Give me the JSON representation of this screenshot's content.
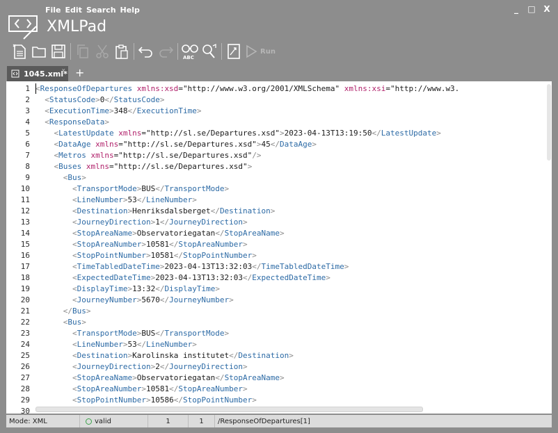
{
  "app": {
    "title": "XMLPad",
    "menu": [
      "File",
      "Edit",
      "Search",
      "Help"
    ],
    "window_controls": {
      "minimize": "_",
      "maximize": "□",
      "close": "X"
    }
  },
  "toolbar": {
    "buttons": [
      "new-file-icon",
      "open-folder-icon",
      "save-icon",
      "copy-icon",
      "cut-icon",
      "paste-icon",
      "undo-icon",
      "redo-icon",
      "spellcheck-icon",
      "find-replace-icon",
      "xpath-icon",
      "run-icon"
    ],
    "run_label": "Run"
  },
  "tabs": [
    {
      "label": "1045.xml*",
      "close": "x"
    }
  ],
  "tab_add": "+",
  "editor": {
    "lines": [
      [
        [
          "b",
          "<"
        ],
        [
          "t",
          "ResponseOfDepartures"
        ],
        [
          "x",
          " "
        ],
        [
          "a",
          "xmlns:xsd"
        ],
        [
          "e",
          "="
        ],
        [
          "v",
          "\"http://www.w3.org/2001/XMLSchema\""
        ],
        [
          "x",
          " "
        ],
        [
          "a",
          "xmlns:xsi"
        ],
        [
          "e",
          "="
        ],
        [
          "v",
          "\"http://www.w3."
        ]
      ],
      [
        [
          "x",
          "  "
        ],
        [
          "b",
          "<"
        ],
        [
          "t",
          "StatusCode"
        ],
        [
          "b",
          ">"
        ],
        [
          "x",
          "0"
        ],
        [
          "b",
          "</"
        ],
        [
          "t",
          "StatusCode"
        ],
        [
          "b",
          ">"
        ]
      ],
      [
        [
          "x",
          "  "
        ],
        [
          "b",
          "<"
        ],
        [
          "t",
          "ExecutionTime"
        ],
        [
          "b",
          ">"
        ],
        [
          "x",
          "348"
        ],
        [
          "b",
          "</"
        ],
        [
          "t",
          "ExecutionTime"
        ],
        [
          "b",
          ">"
        ]
      ],
      [
        [
          "x",
          "  "
        ],
        [
          "b",
          "<"
        ],
        [
          "t",
          "ResponseData"
        ],
        [
          "b",
          ">"
        ]
      ],
      [
        [
          "x",
          "    "
        ],
        [
          "b",
          "<"
        ],
        [
          "t",
          "LatestUpdate"
        ],
        [
          "x",
          " "
        ],
        [
          "a",
          "xmlns"
        ],
        [
          "e",
          "="
        ],
        [
          "v",
          "\"http://sl.se/Departures.xsd\""
        ],
        [
          "b",
          ">"
        ],
        [
          "x",
          "2023-04-13T13:19:50"
        ],
        [
          "b",
          "</"
        ],
        [
          "t",
          "LatestUpdate"
        ],
        [
          "b",
          ">"
        ]
      ],
      [
        [
          "x",
          "    "
        ],
        [
          "b",
          "<"
        ],
        [
          "t",
          "DataAge"
        ],
        [
          "x",
          " "
        ],
        [
          "a",
          "xmlns"
        ],
        [
          "e",
          "="
        ],
        [
          "v",
          "\"http://sl.se/Departures.xsd\""
        ],
        [
          "b",
          ">"
        ],
        [
          "x",
          "45"
        ],
        [
          "b",
          "</"
        ],
        [
          "t",
          "DataAge"
        ],
        [
          "b",
          ">"
        ]
      ],
      [
        [
          "x",
          "    "
        ],
        [
          "b",
          "<"
        ],
        [
          "t",
          "Metros"
        ],
        [
          "x",
          " "
        ],
        [
          "a",
          "xmlns"
        ],
        [
          "e",
          "="
        ],
        [
          "v",
          "\"http://sl.se/Departures.xsd\""
        ],
        [
          "b",
          "/>"
        ]
      ],
      [
        [
          "x",
          "    "
        ],
        [
          "b",
          "<"
        ],
        [
          "t",
          "Buses"
        ],
        [
          "x",
          " "
        ],
        [
          "a",
          "xmlns"
        ],
        [
          "e",
          "="
        ],
        [
          "v",
          "\"http://sl.se/Departures.xsd\""
        ],
        [
          "b",
          ">"
        ]
      ],
      [
        [
          "x",
          "      "
        ],
        [
          "b",
          "<"
        ],
        [
          "t",
          "Bus"
        ],
        [
          "b",
          ">"
        ]
      ],
      [
        [
          "x",
          "        "
        ],
        [
          "b",
          "<"
        ],
        [
          "t",
          "TransportMode"
        ],
        [
          "b",
          ">"
        ],
        [
          "x",
          "BUS"
        ],
        [
          "b",
          "</"
        ],
        [
          "t",
          "TransportMode"
        ],
        [
          "b",
          ">"
        ]
      ],
      [
        [
          "x",
          "        "
        ],
        [
          "b",
          "<"
        ],
        [
          "t",
          "LineNumber"
        ],
        [
          "b",
          ">"
        ],
        [
          "x",
          "53"
        ],
        [
          "b",
          "</"
        ],
        [
          "t",
          "LineNumber"
        ],
        [
          "b",
          ">"
        ]
      ],
      [
        [
          "x",
          "        "
        ],
        [
          "b",
          "<"
        ],
        [
          "t",
          "Destination"
        ],
        [
          "b",
          ">"
        ],
        [
          "x",
          "Henriksdalsberget"
        ],
        [
          "b",
          "</"
        ],
        [
          "t",
          "Destination"
        ],
        [
          "b",
          ">"
        ]
      ],
      [
        [
          "x",
          "        "
        ],
        [
          "b",
          "<"
        ],
        [
          "t",
          "JourneyDirection"
        ],
        [
          "b",
          ">"
        ],
        [
          "x",
          "1"
        ],
        [
          "b",
          "</"
        ],
        [
          "t",
          "JourneyDirection"
        ],
        [
          "b",
          ">"
        ]
      ],
      [
        [
          "x",
          "        "
        ],
        [
          "b",
          "<"
        ],
        [
          "t",
          "StopAreaName"
        ],
        [
          "b",
          ">"
        ],
        [
          "x",
          "Observatoriegatan"
        ],
        [
          "b",
          "</"
        ],
        [
          "t",
          "StopAreaName"
        ],
        [
          "b",
          ">"
        ]
      ],
      [
        [
          "x",
          "        "
        ],
        [
          "b",
          "<"
        ],
        [
          "t",
          "StopAreaNumber"
        ],
        [
          "b",
          ">"
        ],
        [
          "x",
          "10581"
        ],
        [
          "b",
          "</"
        ],
        [
          "t",
          "StopAreaNumber"
        ],
        [
          "b",
          ">"
        ]
      ],
      [
        [
          "x",
          "        "
        ],
        [
          "b",
          "<"
        ],
        [
          "t",
          "StopPointNumber"
        ],
        [
          "b",
          ">"
        ],
        [
          "x",
          "10581"
        ],
        [
          "b",
          "</"
        ],
        [
          "t",
          "StopPointNumber"
        ],
        [
          "b",
          ">"
        ]
      ],
      [
        [
          "x",
          "        "
        ],
        [
          "b",
          "<"
        ],
        [
          "t",
          "TimeTabledDateTime"
        ],
        [
          "b",
          ">"
        ],
        [
          "x",
          "2023-04-13T13:32:03"
        ],
        [
          "b",
          "</"
        ],
        [
          "t",
          "TimeTabledDateTime"
        ],
        [
          "b",
          ">"
        ]
      ],
      [
        [
          "x",
          "        "
        ],
        [
          "b",
          "<"
        ],
        [
          "t",
          "ExpectedDateTime"
        ],
        [
          "b",
          ">"
        ],
        [
          "x",
          "2023-04-13T13:32:03"
        ],
        [
          "b",
          "</"
        ],
        [
          "t",
          "ExpectedDateTime"
        ],
        [
          "b",
          ">"
        ]
      ],
      [
        [
          "x",
          "        "
        ],
        [
          "b",
          "<"
        ],
        [
          "t",
          "DisplayTime"
        ],
        [
          "b",
          ">"
        ],
        [
          "x",
          "13:32"
        ],
        [
          "b",
          "</"
        ],
        [
          "t",
          "DisplayTime"
        ],
        [
          "b",
          ">"
        ]
      ],
      [
        [
          "x",
          "        "
        ],
        [
          "b",
          "<"
        ],
        [
          "t",
          "JourneyNumber"
        ],
        [
          "b",
          ">"
        ],
        [
          "x",
          "5670"
        ],
        [
          "b",
          "</"
        ],
        [
          "t",
          "JourneyNumber"
        ],
        [
          "b",
          ">"
        ]
      ],
      [
        [
          "x",
          "      "
        ],
        [
          "b",
          "</"
        ],
        [
          "t",
          "Bus"
        ],
        [
          "b",
          ">"
        ]
      ],
      [
        [
          "x",
          "      "
        ],
        [
          "b",
          "<"
        ],
        [
          "t",
          "Bus"
        ],
        [
          "b",
          ">"
        ]
      ],
      [
        [
          "x",
          "        "
        ],
        [
          "b",
          "<"
        ],
        [
          "t",
          "TransportMode"
        ],
        [
          "b",
          ">"
        ],
        [
          "x",
          "BUS"
        ],
        [
          "b",
          "</"
        ],
        [
          "t",
          "TransportMode"
        ],
        [
          "b",
          ">"
        ]
      ],
      [
        [
          "x",
          "        "
        ],
        [
          "b",
          "<"
        ],
        [
          "t",
          "LineNumber"
        ],
        [
          "b",
          ">"
        ],
        [
          "x",
          "53"
        ],
        [
          "b",
          "</"
        ],
        [
          "t",
          "LineNumber"
        ],
        [
          "b",
          ">"
        ]
      ],
      [
        [
          "x",
          "        "
        ],
        [
          "b",
          "<"
        ],
        [
          "t",
          "Destination"
        ],
        [
          "b",
          ">"
        ],
        [
          "x",
          "Karolinska institutet"
        ],
        [
          "b",
          "</"
        ],
        [
          "t",
          "Destination"
        ],
        [
          "b",
          ">"
        ]
      ],
      [
        [
          "x",
          "        "
        ],
        [
          "b",
          "<"
        ],
        [
          "t",
          "JourneyDirection"
        ],
        [
          "b",
          ">"
        ],
        [
          "x",
          "2"
        ],
        [
          "b",
          "</"
        ],
        [
          "t",
          "JourneyDirection"
        ],
        [
          "b",
          ">"
        ]
      ],
      [
        [
          "x",
          "        "
        ],
        [
          "b",
          "<"
        ],
        [
          "t",
          "StopAreaName"
        ],
        [
          "b",
          ">"
        ],
        [
          "x",
          "Observatoriegatan"
        ],
        [
          "b",
          "</"
        ],
        [
          "t",
          "StopAreaName"
        ],
        [
          "b",
          ">"
        ]
      ],
      [
        [
          "x",
          "        "
        ],
        [
          "b",
          "<"
        ],
        [
          "t",
          "StopAreaNumber"
        ],
        [
          "b",
          ">"
        ],
        [
          "x",
          "10581"
        ],
        [
          "b",
          "</"
        ],
        [
          "t",
          "StopAreaNumber"
        ],
        [
          "b",
          ">"
        ]
      ],
      [
        [
          "x",
          "        "
        ],
        [
          "b",
          "<"
        ],
        [
          "t",
          "StopPointNumber"
        ],
        [
          "b",
          ">"
        ],
        [
          "x",
          "10586"
        ],
        [
          "b",
          "</"
        ],
        [
          "t",
          "StopPointNumber"
        ],
        [
          "b",
          ">"
        ]
      ],
      []
    ]
  },
  "statusbar": {
    "mode": "Mode: XML",
    "validity": "valid",
    "line": "1",
    "column": "1",
    "xpath": "/ResponseOfDepartures[1]"
  }
}
